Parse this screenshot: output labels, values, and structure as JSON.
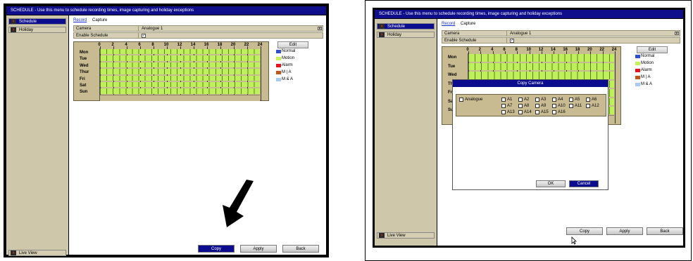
{
  "title": "SCHEDULE - Use this menu to schedule recording times, image capturing and holiday exceptions",
  "sidebar": {
    "schedule": "Schedule",
    "holiday": "Holiday",
    "live_view": "Live View"
  },
  "tabs": {
    "record": "Record",
    "capture": "Capture"
  },
  "camera": {
    "label": "Camera",
    "value": "Analogue 1"
  },
  "enable_schedule": {
    "label": "Enable Schedule",
    "checked_mark": "✓"
  },
  "hours": [
    "0",
    "2",
    "4",
    "6",
    "8",
    "10",
    "12",
    "14",
    "16",
    "18",
    "20",
    "22",
    "24"
  ],
  "days": [
    "Mon",
    "Tue",
    "Wed",
    "Thur",
    "Fri",
    "Sat",
    "Sun"
  ],
  "edit_label": "Edit",
  "legend": [
    {
      "label": "Normal",
      "color": "#2e4fd0"
    },
    {
      "label": "Motion",
      "color": "#c5f35a"
    },
    {
      "label": "Alarm",
      "color": "#e8121a"
    },
    {
      "label": "M | A",
      "color": "#c2541a"
    },
    {
      "label": "M & A",
      "color": "#a9c8f2"
    }
  ],
  "buttons": {
    "copy": "Copy",
    "apply": "Apply",
    "back": "Back"
  },
  "copy_dialog": {
    "title": "Copy Camera",
    "analogue": "Analogue",
    "cameras": [
      "A1",
      "A2",
      "A3",
      "A4",
      "A5",
      "A6",
      "A7",
      "A8",
      "A9",
      "A10",
      "A11",
      "A12",
      "A13",
      "A14",
      "A15",
      "A16"
    ],
    "ok": "OK",
    "cancel": "Cancel"
  }
}
